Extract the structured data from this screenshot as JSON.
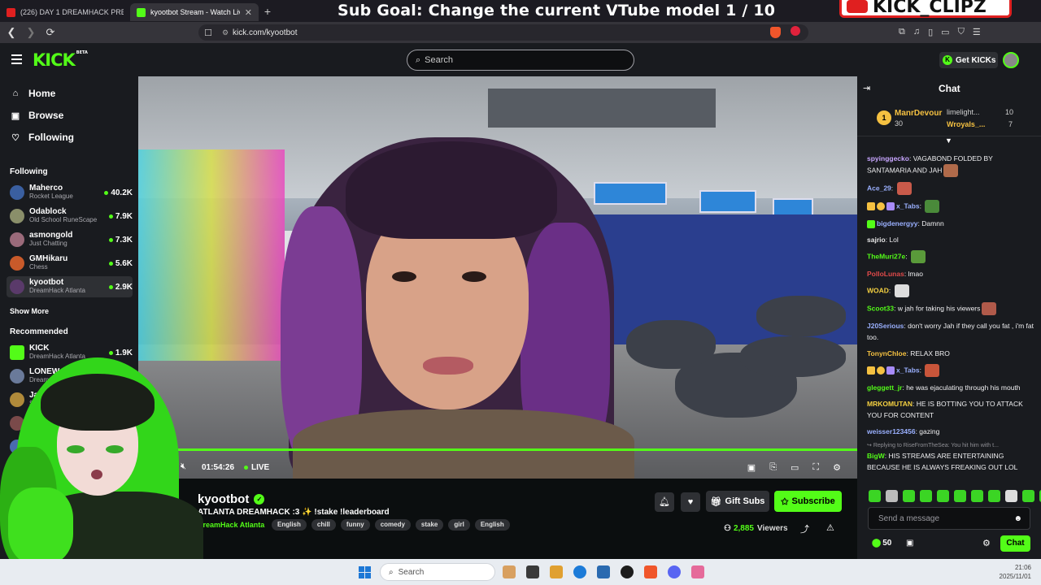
{
  "browser": {
    "tabs": [
      {
        "title": "(226) DAY 1 DREAMHACK PRESSTEN",
        "active": false,
        "favicon_color": "#e02020"
      },
      {
        "title": "kyootbot Stream - Watch Live on",
        "active": true,
        "favicon_color": "#53fc18"
      }
    ],
    "new_tab": "+",
    "url": "kick.com/kyootbot"
  },
  "overlay": {
    "sub_goal": "Sub Goal: Change the current VTube model  1 / 10",
    "logo_text": "KICK_CLIPZ"
  },
  "header": {
    "logo": "KICK",
    "logo_badge": "BETA",
    "search_placeholder": "Search",
    "get_kicks": "Get KICKs"
  },
  "sidebar": {
    "nav": [
      {
        "label": "Home",
        "icon": "home-icon"
      },
      {
        "label": "Browse",
        "icon": "browse-icon"
      },
      {
        "label": "Following",
        "icon": "heart-icon"
      }
    ],
    "following_heading": "Following",
    "following": [
      {
        "name": "Maherco",
        "game": "Rocket League",
        "viewers": "40.2K",
        "color": "#3a5fa0"
      },
      {
        "name": "Odablock",
        "game": "Old School RuneScape",
        "viewers": "7.9K",
        "color": "#8a8f6a"
      },
      {
        "name": "asmongold",
        "game": "Just Chatting",
        "viewers": "7.3K",
        "color": "#9a6a7a"
      },
      {
        "name": "GMHikaru",
        "game": "Chess",
        "viewers": "5.6K",
        "color": "#c85a2a"
      },
      {
        "name": "kyootbot",
        "game": "DreamHack Atlanta",
        "viewers": "2.9K",
        "color": "#5a3a6a"
      }
    ],
    "show_more": "Show More",
    "recommended_heading": "Recommended",
    "recommended": [
      {
        "name": "KICK",
        "game": "DreamHack Atlanta",
        "viewers": "1.9K",
        "color": "#53fc18"
      },
      {
        "name": "LONEW",
        "game": "Dream",
        "viewers": "",
        "color": "#6a7a9a"
      },
      {
        "name": "Jay",
        "game": "Slot",
        "viewers": "",
        "color": "#b08a3a"
      },
      {
        "name": "ian",
        "game": "Dre",
        "viewers": "",
        "color": "#7a4a4a"
      },
      {
        "name": "hitv",
        "game": "Cou",
        "viewers": "",
        "color": "#4a6ab0"
      },
      {
        "name": "CC",
        "game": "",
        "viewers": "",
        "color": "#cfcfcf"
      }
    ]
  },
  "player": {
    "time": "01:54:26",
    "live": "LIVE",
    "progress": 1.0
  },
  "stream": {
    "streamer": "kyootbot",
    "title": "ATLANTA DREAMHACK :3 ✨  !stake !leaderboard",
    "category": "DreamHack Atlanta",
    "tags": [
      "English",
      "chill",
      "funny",
      "comedy",
      "stake",
      "girl",
      "English"
    ],
    "gift_subs": "Gift Subs",
    "subscribe": "Subscribe",
    "viewers": "2,885",
    "viewers_label": "Viewers"
  },
  "chat": {
    "title": "Chat",
    "leaderboard": [
      {
        "rank": "1",
        "name": "ManrDevour",
        "count": "30"
      },
      {
        "name": "limelight...",
        "count": "10"
      },
      {
        "name": "Wroyals_...",
        "count": "7"
      }
    ],
    "messages": [
      {
        "user": "spyinggecko",
        "color": "#c8a6ff",
        "text": "VAGABOND FOLDED BY SANTAMARIA AND JAH",
        "emote": "#b06a4a"
      },
      {
        "user": "Ace_29",
        "color": "#9ab0ff",
        "text": "",
        "emote": "#c85a4a"
      },
      {
        "user": "x_Tabs",
        "color": "#9ab0ff",
        "text": "",
        "emote": "#4a8a3a",
        "badges": true
      },
      {
        "user": "bigdenergyy",
        "color": "#9ab0ff",
        "text": "Damnn"
      },
      {
        "user": "sajrio",
        "color": "#e6e6e6",
        "text": "Lol"
      },
      {
        "user": "TheMuri27e",
        "color": "#53fc18",
        "text": "",
        "emote": "#5a9a3a"
      },
      {
        "user": "PolloLunas",
        "color": "#e04a4a",
        "text": "lmao"
      },
      {
        "user": "WOAD",
        "color": "#f5d141",
        "text": "",
        "emote": "#dddddd"
      },
      {
        "user": "Scoot33",
        "color": "#53fc18",
        "text": "w jah for taking his viewers",
        "emote": "#b05a4a"
      },
      {
        "user": "J20Serious",
        "color": "#9ab0ff",
        "text": "don't worry Jah if they call you fat , i'm fat too."
      },
      {
        "user": "TonynChloe",
        "color": "#f5c141",
        "text": "RELAX BRO"
      },
      {
        "user": "x_Tabs",
        "color": "#9ab0ff",
        "text": "",
        "emote": "#c8553a",
        "badges": true
      },
      {
        "user": "gleggett_jr",
        "color": "#53fc18",
        "text": "he was ejaculating through his mouth"
      },
      {
        "user": "MRKOMUTAN",
        "color": "#f5d141",
        "text": "HE IS BOTTING YOU TO ATTACK YOU FOR CONTENT"
      },
      {
        "user": "weisser123456",
        "color": "#9ab0ff",
        "text": "gazing"
      },
      {
        "user": "BigW",
        "color": "#53fc18",
        "text": "HIS STREAMS ARE ENTERTAINING BECAUSE HE IS ALWAYS FREAKING OUT LOL",
        "reply": "Replying to RiseFromTheSea: You hit him with t..."
      }
    ],
    "send_placeholder": "Send a message",
    "kicks": "50",
    "chat_button": "Chat"
  },
  "taskbar": {
    "search": "Search",
    "time": "21:06",
    "date": "2025/11/01",
    "apps": [
      "#d8a060",
      "#3a3a3a",
      "#e0a030",
      "#1c7bd8",
      "#2a6ab0",
      "#1c1c1c",
      "#f0562b",
      "#5865f2",
      "#e56a9a"
    ]
  }
}
